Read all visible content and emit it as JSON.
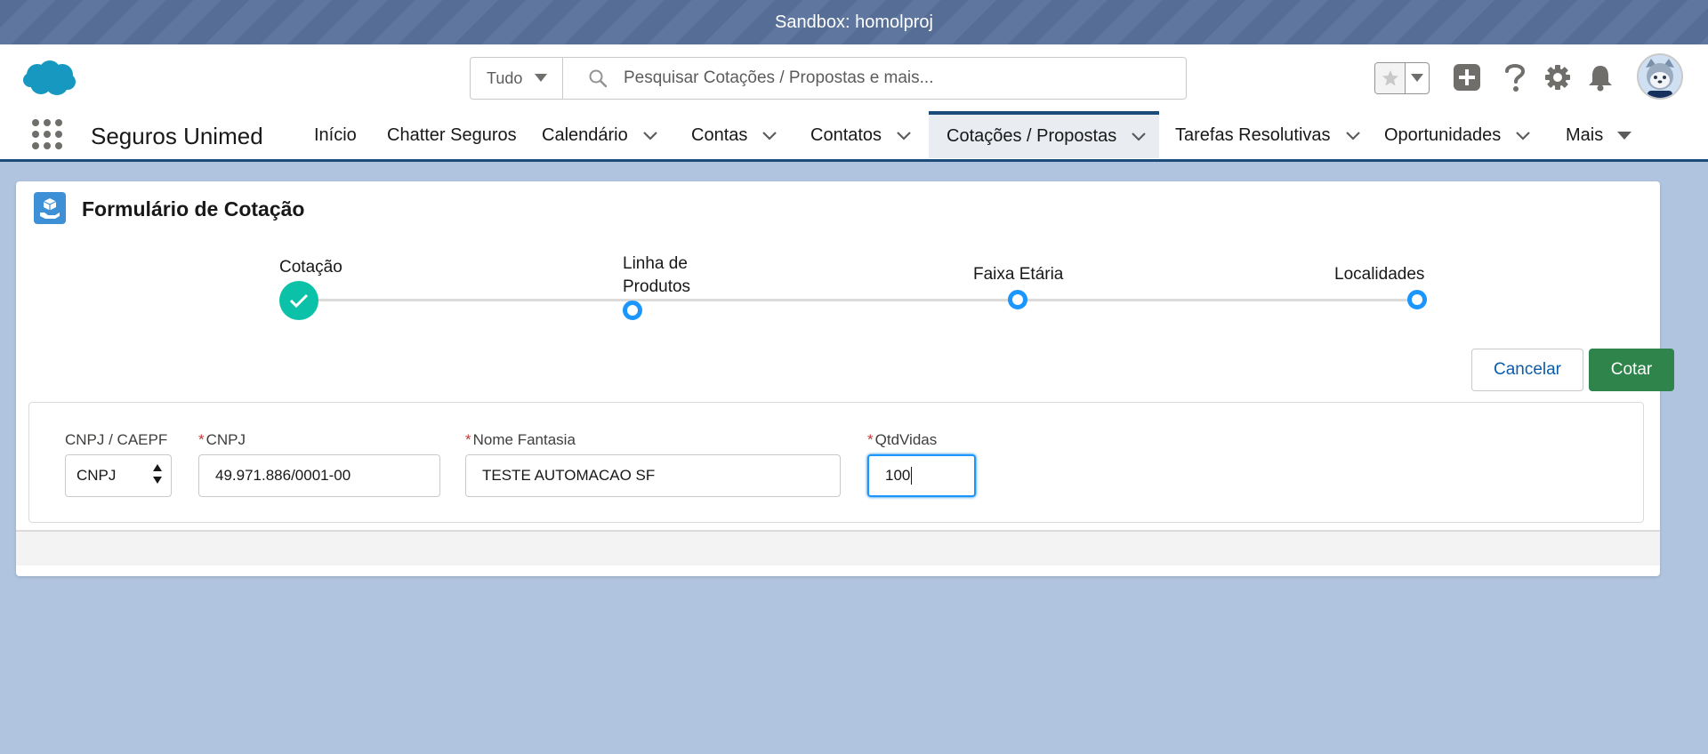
{
  "sandbox": {
    "label": "Sandbox: homolproj"
  },
  "search": {
    "scope": "Tudo",
    "placeholder": "Pesquisar Cotações / Propostas e mais..."
  },
  "app": {
    "name": "Seguros Unimed"
  },
  "nav": {
    "items": [
      {
        "label": "Início",
        "has_menu": false
      },
      {
        "label": "Chatter Seguros",
        "has_menu": false
      },
      {
        "label": "Calendário",
        "has_menu": true
      },
      {
        "label": "Contas",
        "has_menu": true
      },
      {
        "label": "Contatos",
        "has_menu": true
      },
      {
        "label": "Cotações / Propostas",
        "has_menu": true,
        "active": true
      },
      {
        "label": "Tarefas Resolutivas",
        "has_menu": true
      },
      {
        "label": "Oportunidades",
        "has_menu": true
      },
      {
        "label": "Mais",
        "has_menu": true
      }
    ]
  },
  "card": {
    "title": "Formulário de Cotação"
  },
  "progress": {
    "steps": [
      {
        "label": "Cotação",
        "status": "complete"
      },
      {
        "label": "Linha de Produtos",
        "status": "open"
      },
      {
        "label": "Faixa Etária",
        "status": "open"
      },
      {
        "label": "Localidades",
        "status": "open"
      }
    ]
  },
  "actions": {
    "cancel": "Cancelar",
    "submit": "Cotar"
  },
  "form": {
    "doc_type": {
      "label": "CNPJ / CAEPF",
      "value": "CNPJ"
    },
    "cnpj": {
      "label": "CNPJ",
      "required": true,
      "value": "49.971.886/0001-00"
    },
    "nome_fantasia": {
      "label": "Nome Fantasia",
      "required": true,
      "value": "TESTE AUTOMACAO SF"
    },
    "qtd_vidas": {
      "label": "QtdVidas",
      "required": true,
      "value": "100"
    }
  },
  "colors": {
    "brand_green": "#2e844a",
    "progress_complete": "#0bc1a8",
    "progress_open": "#1b96ff",
    "nav_active": "#1b4b78",
    "background": "#b0c4df"
  }
}
